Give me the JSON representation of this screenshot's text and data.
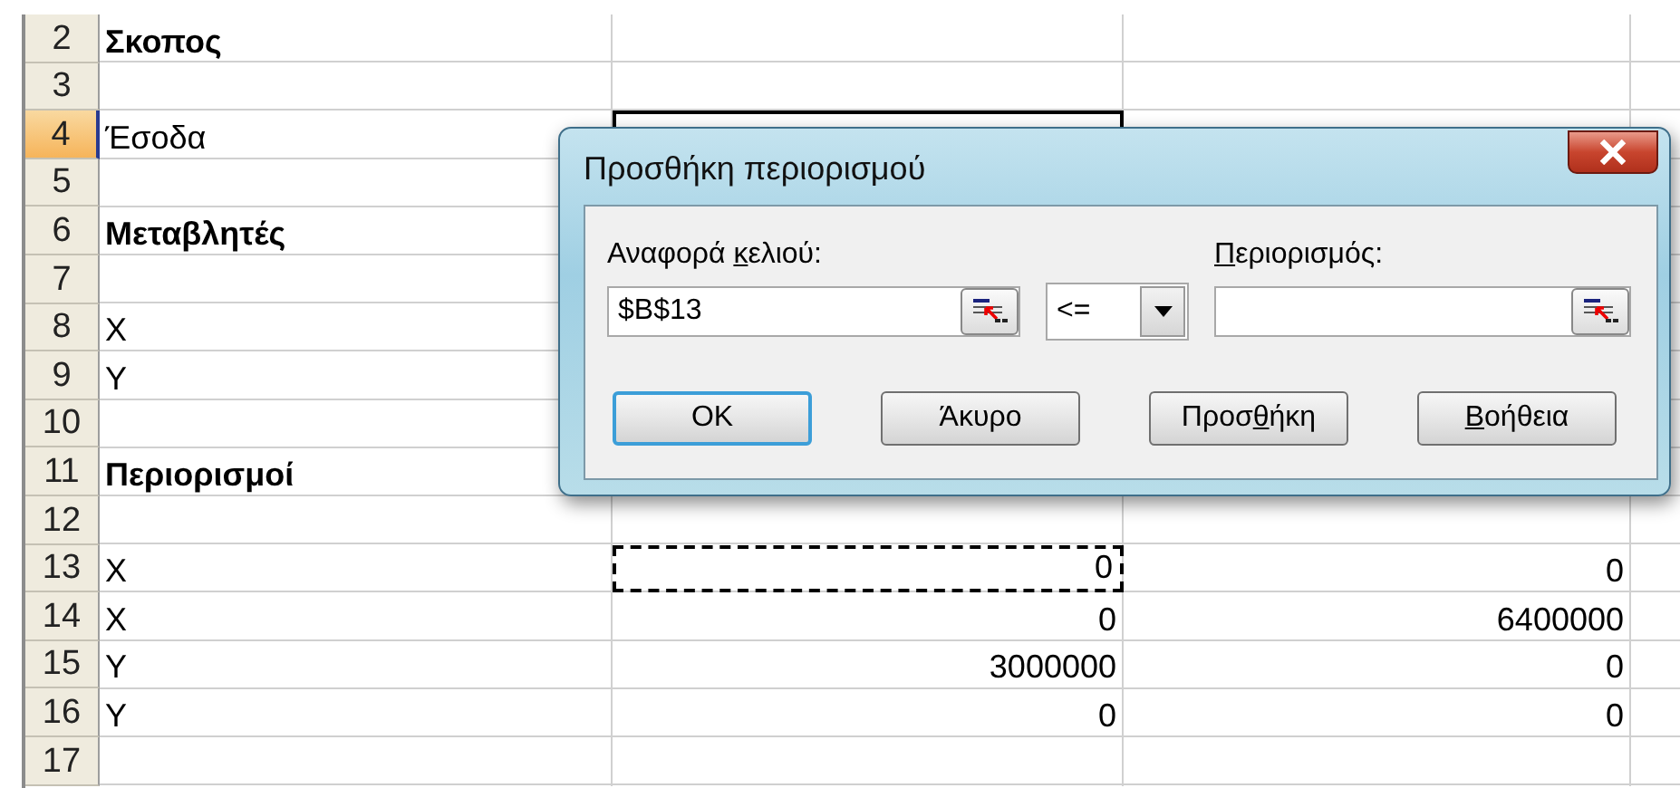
{
  "sheet": {
    "rows": [
      {
        "number": "2",
        "kind": "heading",
        "selected": false,
        "cells": [
          "Σκοπος",
          "",
          ""
        ]
      },
      {
        "number": "3",
        "kind": "data",
        "selected": false,
        "cells": [
          "",
          "",
          ""
        ]
      },
      {
        "number": "4",
        "kind": "data",
        "selected": true,
        "cells": [
          "Έσοδα",
          "",
          ""
        ]
      },
      {
        "number": "5",
        "kind": "data",
        "selected": false,
        "cells": [
          "",
          "",
          ""
        ]
      },
      {
        "number": "6",
        "kind": "heading",
        "selected": false,
        "cells": [
          "Μεταβλητές",
          "",
          ""
        ]
      },
      {
        "number": "7",
        "kind": "data",
        "selected": false,
        "cells": [
          "",
          "",
          ""
        ]
      },
      {
        "number": "8",
        "kind": "data",
        "selected": false,
        "cells": [
          "X",
          "",
          ""
        ]
      },
      {
        "number": "9",
        "kind": "data",
        "selected": false,
        "cells": [
          "Y",
          "",
          ""
        ]
      },
      {
        "number": "10",
        "kind": "data",
        "selected": false,
        "cells": [
          "",
          "",
          ""
        ]
      },
      {
        "number": "11",
        "kind": "heading",
        "selected": false,
        "cells": [
          "Περιορισμοί",
          "",
          ""
        ]
      },
      {
        "number": "12",
        "kind": "data",
        "selected": false,
        "marquee": false,
        "cells": [
          "",
          "",
          ""
        ]
      },
      {
        "number": "13",
        "kind": "data",
        "selected": false,
        "marquee": true,
        "cells": [
          "X",
          "0",
          "0"
        ]
      },
      {
        "number": "14",
        "kind": "data",
        "selected": false,
        "marquee": false,
        "cells": [
          "X",
          "0",
          "6400000"
        ]
      },
      {
        "number": "15",
        "kind": "data",
        "selected": false,
        "marquee": false,
        "cells": [
          "Y",
          "3000000",
          "0"
        ]
      },
      {
        "number": "16",
        "kind": "data",
        "selected": false,
        "marquee": false,
        "cells": [
          "Y",
          "0",
          "0"
        ]
      },
      {
        "number": "17",
        "kind": "data",
        "selected": false,
        "marquee": false,
        "cells": [
          "",
          "",
          ""
        ]
      }
    ]
  },
  "dialog": {
    "title": "Προσθήκη περιορισμού",
    "cell_reference": {
      "label": [
        {
          "text": "Αναφορά ",
          "underlined": false
        },
        {
          "text": "κ",
          "underlined": true
        },
        {
          "text": "ελιού:",
          "underlined": false
        }
      ],
      "value": "$B$13"
    },
    "operator": {
      "value": "<="
    },
    "constraint": {
      "label": [
        {
          "text": "Π",
          "underlined": true
        },
        {
          "text": "εριορισμός:",
          "underlined": false
        }
      ]
    },
    "buttons": [
      {
        "label": [
          {
            "text": "OK",
            "underlined": false
          }
        ],
        "default": true
      },
      {
        "label": [
          {
            "text": "Άκυρο",
            "underlined": false
          }
        ],
        "default": false
      },
      {
        "label": [
          {
            "text": "Προσ",
            "underlined": false
          },
          {
            "text": "θ",
            "underlined": true
          },
          {
            "text": "ήκη",
            "underlined": false
          }
        ],
        "default": false
      },
      {
        "label": [
          {
            "text": "Β",
            "underlined": true
          },
          {
            "text": "οήθεια",
            "underlined": false
          }
        ],
        "default": false
      }
    ]
  }
}
